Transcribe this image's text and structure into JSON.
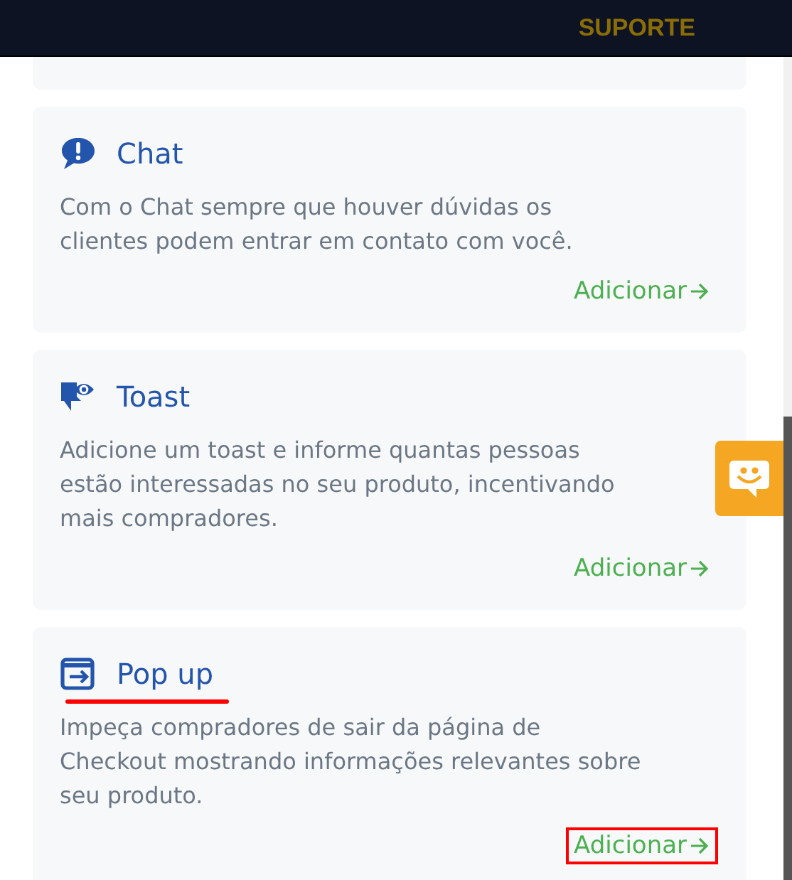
{
  "header": {
    "link": "SUPORTE"
  },
  "cards": [
    {
      "kind": "chat",
      "title": "Chat",
      "description": "Com o Chat sempre que houver dúvidas os clientes podem entrar em contato com você.",
      "action": "Adicionar",
      "annotated": false
    },
    {
      "kind": "toast",
      "title": "Toast",
      "description": "Adicione um toast e informe quantas pessoas estão interessadas no seu produto, incentivando mais compradores.",
      "action": "Adicionar",
      "annotated": false
    },
    {
      "kind": "popup",
      "title": "Pop up",
      "description": "Impeça compradores de sair da página de Checkout mostrando informações relevantes sobre seu produto.",
      "action": "Adicionar",
      "annotated": true
    }
  ]
}
